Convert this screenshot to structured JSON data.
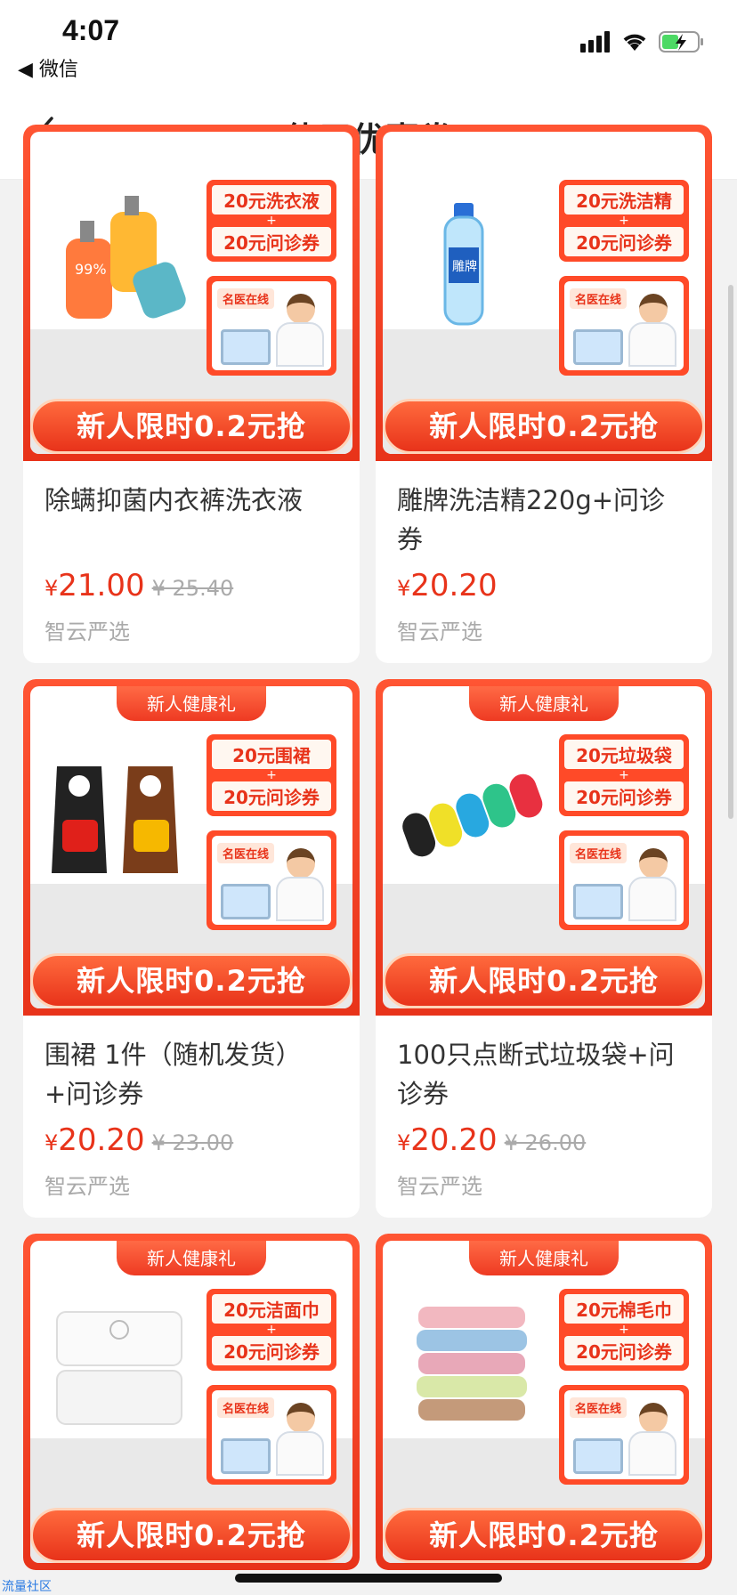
{
  "status": {
    "time": "4:07",
    "back_app": "◀ 微信"
  },
  "nav": {
    "title": "使用优惠券"
  },
  "products": [
    {
      "tag": "",
      "promo_top": "20元洗衣液",
      "promo_bottom": "20元问诊券",
      "doctor_tag": "名医在线",
      "cta": "新人限时0.2元抢",
      "name": "除螨抑菌内衣裤洗衣液",
      "price": "21.00",
      "old_price": "¥ 25.40",
      "shop": "智云严选",
      "icon": "laundry-detergent-bottles"
    },
    {
      "tag": "",
      "promo_top": "20元洗洁精",
      "promo_bottom": "20元问诊券",
      "doctor_tag": "名医在线",
      "cta": "新人限时0.2元抢",
      "name": "雕牌洗洁精220g+问诊券",
      "price": "20.20",
      "old_price": "",
      "shop": "智云严选",
      "icon": "dish-soap-bottle"
    },
    {
      "tag": "新人健康礼",
      "promo_top": "20元围裙",
      "promo_bottom": "20元问诊券",
      "doctor_tag": "名医在线",
      "cta": "新人限时0.2元抢",
      "name": "围裙 1件（随机发货）+问诊券",
      "price": "20.20",
      "old_price": "¥ 23.00",
      "shop": "智云严选",
      "icon": "aprons"
    },
    {
      "tag": "新人健康礼",
      "promo_top": "20元垃圾袋",
      "promo_bottom": "20元问诊券",
      "doctor_tag": "名医在线",
      "cta": "新人限时0.2元抢",
      "name": "100只点断式垃圾袋+问诊券",
      "price": "20.20",
      "old_price": "¥ 26.00",
      "shop": "智云严选",
      "icon": "garbage-bag-rolls"
    },
    {
      "tag": "新人健康礼",
      "promo_top": "20元洁面巾",
      "promo_bottom": "20元问诊券",
      "doctor_tag": "名医在线",
      "cta": "新人限时0.2元抢",
      "name": "",
      "price": "",
      "old_price": "",
      "shop": "",
      "icon": "face-towel-packs"
    },
    {
      "tag": "新人健康礼",
      "promo_top": "20元棉毛巾",
      "promo_bottom": "20元问诊券",
      "doctor_tag": "名医在线",
      "cta": "新人限时0.2元抢",
      "name": "",
      "price": "",
      "old_price": "",
      "shop": "",
      "icon": "towel-stack"
    }
  ],
  "currency": "¥",
  "watermark": "流量社区"
}
